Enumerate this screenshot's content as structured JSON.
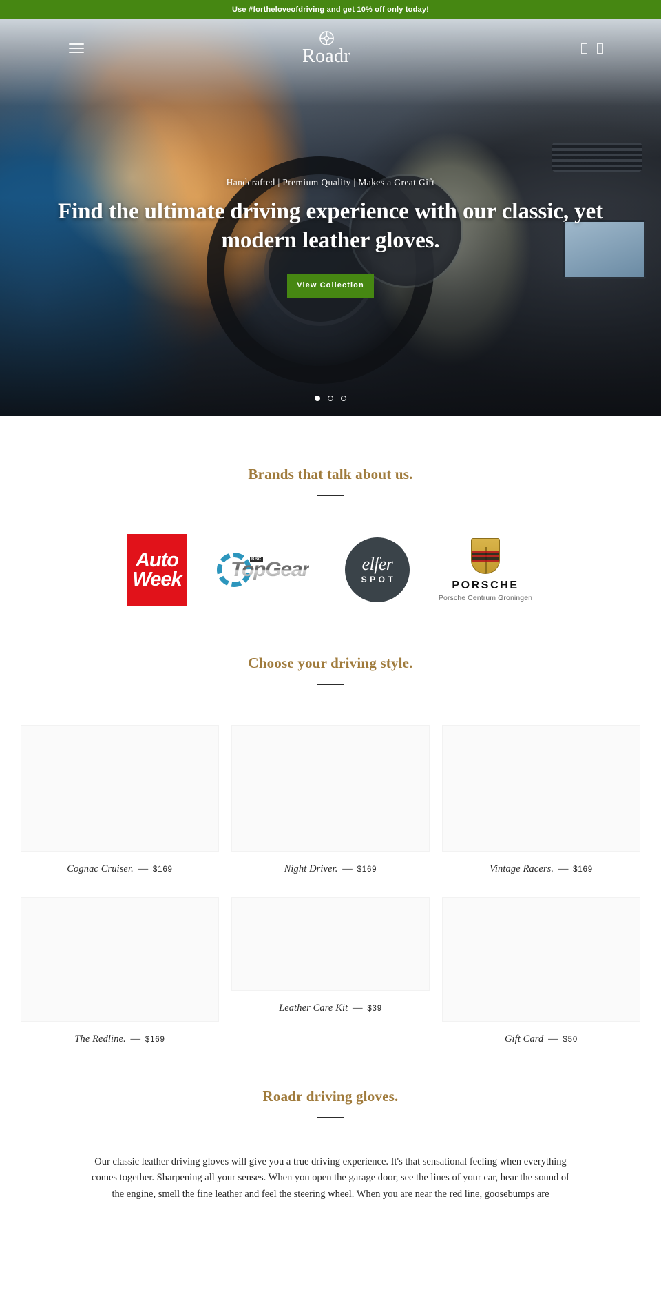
{
  "announcement": {
    "text": "Use #fortheloveofdriving and get 10% off only today!",
    "background": "#468712"
  },
  "header": {
    "menu_icon": "hamburger-icon",
    "logo_mark": "steering-wheel-icon",
    "logo_text": "Roadr",
    "actions": [
      {
        "name": "search-icon"
      },
      {
        "name": "cart-icon"
      }
    ]
  },
  "hero": {
    "eyebrow": "Handcrafted | Premium Quality | Makes a Great Gift",
    "title": "Find the ultimate driving experience with our classic, yet modern leather gloves.",
    "button_label": "View Collection",
    "button_color": "#468712",
    "slides": 3,
    "active_slide": 1
  },
  "brands": {
    "title": "Brands that talk about us.",
    "logos": [
      {
        "name": "autoweek-logo",
        "line1": "Auto",
        "line2": "Week",
        "color": "#e1121a"
      },
      {
        "name": "topgear-logo",
        "badge": "BBC",
        "word": "TopGear"
      },
      {
        "name": "elferspot-logo",
        "script": "elfer",
        "word": "SPOT"
      },
      {
        "name": "porsche-logo",
        "word": "PORSCHE",
        "sub": "Porsche Centrum Groningen"
      }
    ]
  },
  "styles": {
    "title": "Choose your driving style.",
    "products": [
      {
        "name": "Cognac Cruiser.",
        "price": "$169"
      },
      {
        "name": "Night Driver.",
        "price": "$169"
      },
      {
        "name": "Vintage Racers.",
        "price": "$169"
      },
      {
        "name": "The Redline.",
        "price": "$169"
      },
      {
        "name": "Leather Care Kit",
        "price": "$39"
      },
      {
        "name": "Gift Card",
        "price": "$50"
      }
    ],
    "dash": "—"
  },
  "about": {
    "title": "Roadr driving gloves.",
    "body": "Our classic leather driving gloves will give you a true driving experience. It's that sensational feeling when everything comes together. Sharpening all your senses. When you open the garage door, see the lines of your car, hear the sound of the engine, smell the fine leather and feel the steering wheel. When you are near the red line, goosebumps are"
  },
  "theme": {
    "accent_gold": "#a07b3c",
    "green": "#468712"
  }
}
